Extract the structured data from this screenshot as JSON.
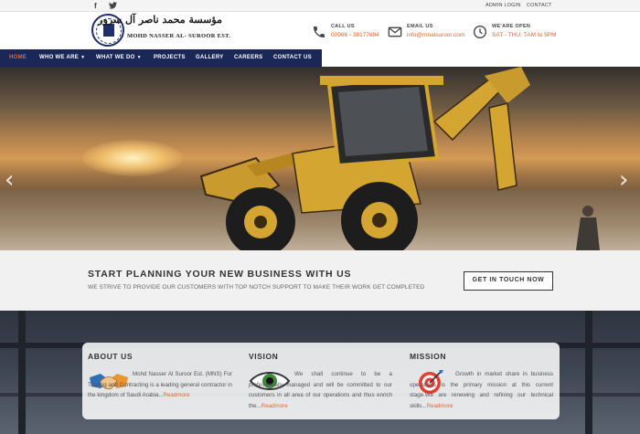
{
  "topbar": {
    "admin_login": "ADMIN LOGIN",
    "contact": "CONTACT",
    "facebook_glyph": "f"
  },
  "logo": {
    "arabic": "مؤسسة محمد ناصر آل سرور",
    "english": "MOHD NASSER AL- SUROOR EST."
  },
  "header_info": {
    "call": {
      "label": "CALL US",
      "value": "00966 - 38177694"
    },
    "email": {
      "label": "EMAIL US",
      "value": "info@mnalsuroor.com"
    },
    "open": {
      "label": "WE'ARE OPEN",
      "value": "SAT - THU, 7AM to 5PM"
    }
  },
  "nav": {
    "items": [
      {
        "label": "HOME",
        "active": true
      },
      {
        "label": "WHO WE ARE",
        "dropdown": true
      },
      {
        "label": "WHAT WE DO",
        "dropdown": true
      },
      {
        "label": "PROJECTS"
      },
      {
        "label": "GALLERY"
      },
      {
        "label": "CAREERS"
      },
      {
        "label": "CONTACT US"
      }
    ]
  },
  "hero": {
    "prev_glyph": "‹",
    "next_glyph": "›"
  },
  "cta": {
    "title": "START PLANNING YOUR NEW BUSINESS WITH US",
    "subtitle": "WE STRIVE TO PROVIDE OUR CUSTOMERS WITH TOP NOTCH SUPPORT TO MAKE THEIR WORK GET COMPLETED",
    "button": "GET IN TOUCH NOW"
  },
  "features": {
    "about": {
      "title": "ABOUT US",
      "text": "Mohd Nasser Al Suroor Est. (MNS) For Trading and Contracting is a leading general contractor in the kingdom of Saudi Arabia...",
      "readmore": "Readmore"
    },
    "vision": {
      "title": "VISION",
      "text": "We shall continue to be a professionally managed and will be committed to our customers in all area of our operations and thus enrich the...",
      "readmore": "Readmore"
    },
    "mission": {
      "title": "MISSION",
      "text": "Growth in market share in business operations is the primary mission at this current stage.We are renewing and refining our technical skills...",
      "readmore": "Readmore"
    }
  },
  "colors": {
    "nav_bg": "#1b2757",
    "accent": "#e8662d",
    "dark_text": "#333333"
  }
}
